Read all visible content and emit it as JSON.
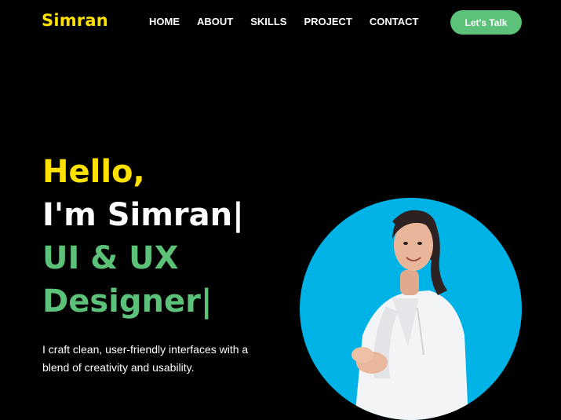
{
  "brand": {
    "logo": "Simran"
  },
  "nav": {
    "items": [
      "HOME",
      "ABOUT",
      "SKILLS",
      "PROJECT",
      "CONTACT"
    ],
    "cta": "Let's Talk"
  },
  "hero": {
    "greeting": "Hello,",
    "intro": "I'm Simran|",
    "role_line1": "UI & UX",
    "role_line2": "Designer|",
    "description": "I craft clean, user-friendly interfaces with a blend of creativity and usability."
  },
  "colors": {
    "background": "#000000",
    "accent_yellow": "#ffe100",
    "accent_green": "#5cc27a",
    "photo_circle": "#00b3e6"
  },
  "icons": {
    "portrait": "portrait-photo"
  }
}
